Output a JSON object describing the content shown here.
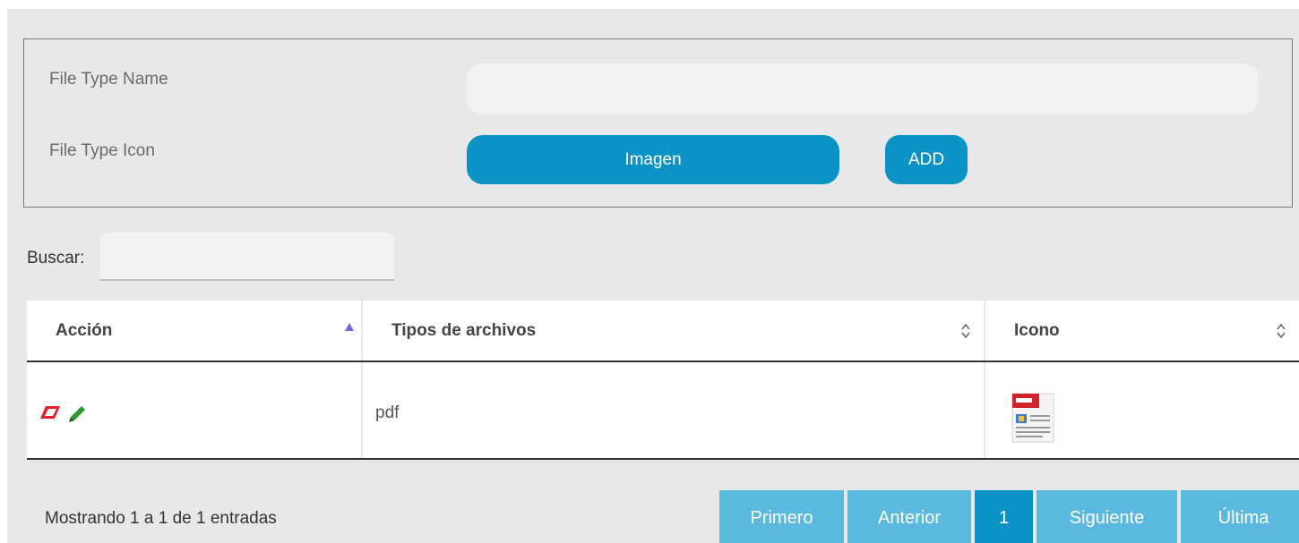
{
  "form": {
    "name_label": "File Type Name",
    "name_value": "",
    "icon_label": "File Type Icon",
    "image_button": "Imagen",
    "add_button": "ADD"
  },
  "search": {
    "label": "Buscar:",
    "value": ""
  },
  "table": {
    "columns": [
      "Acción",
      "Tipos de archivos",
      "Icono"
    ],
    "sort": {
      "column": "Acción",
      "direction": "ascending"
    },
    "rows": [
      {
        "actions": [
          "eraser-icon",
          "pencil-icon"
        ],
        "type": "pdf",
        "icon": "pdf-file-icon"
      }
    ]
  },
  "footer": {
    "info": "Mostrando 1 a 1 de 1 entradas",
    "pagination": {
      "first": "Primero",
      "prev": "Anterior",
      "current": "1",
      "next": "Siguiente",
      "last": "Última"
    }
  },
  "colors": {
    "primary": "#0b93c6",
    "pager": "#5bb8de",
    "background": "#e8e8ea"
  }
}
